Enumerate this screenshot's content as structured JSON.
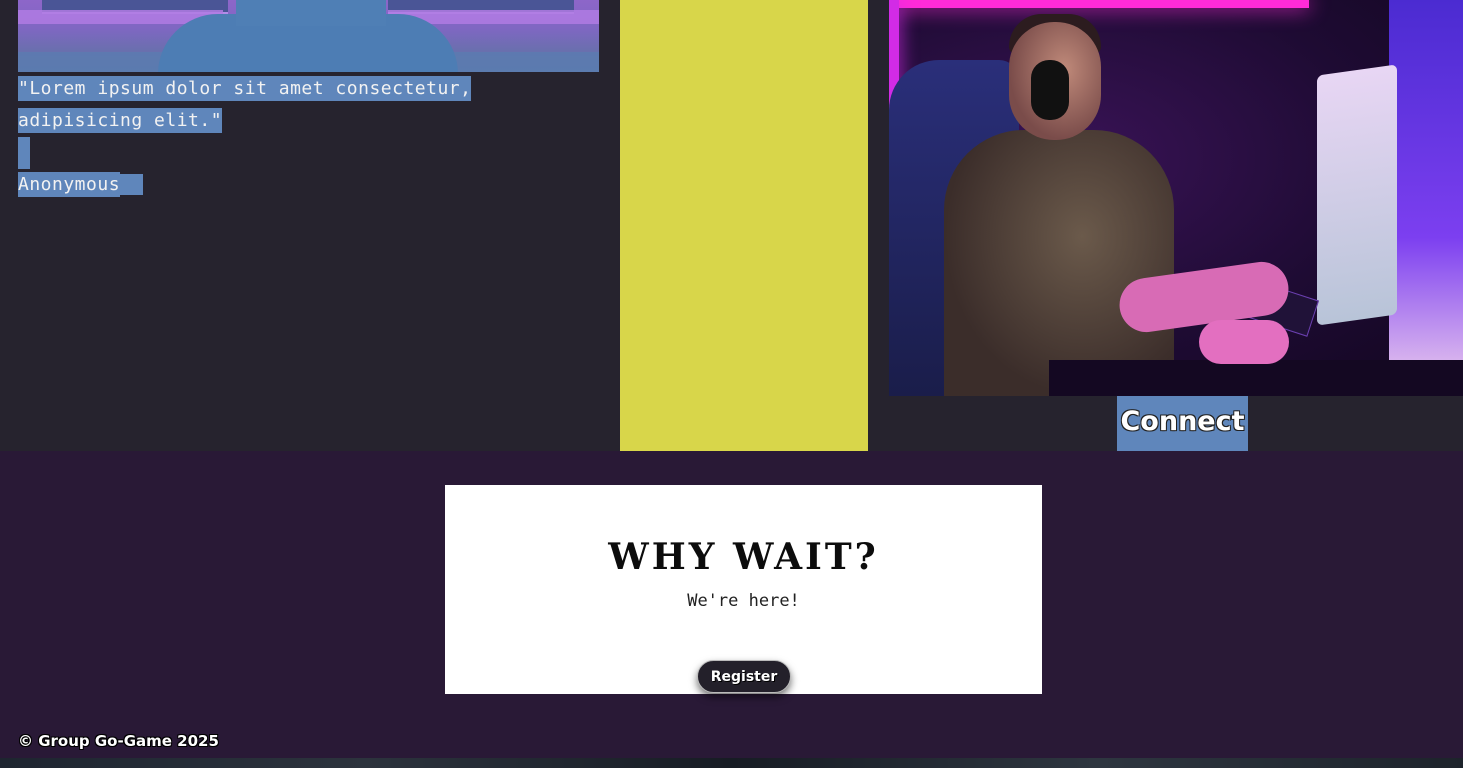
{
  "quote": {
    "line1": "\"Lorem ipsum dolor sit amet consectetur,",
    "line2": "adipisicing elit.\"",
    "author": "Anonymous"
  },
  "connect_label": "Connect",
  "cta": {
    "title": "WHY WAIT?",
    "subtitle": "We're here!",
    "button_label": "Register"
  },
  "footer": {
    "copyright": "© Group Go-Game 2025"
  },
  "colors": {
    "top_bg": "#26232e",
    "bottom_bg": "#291936",
    "yellow_panel": "#d8d64a",
    "selection": "#5f86bb"
  }
}
